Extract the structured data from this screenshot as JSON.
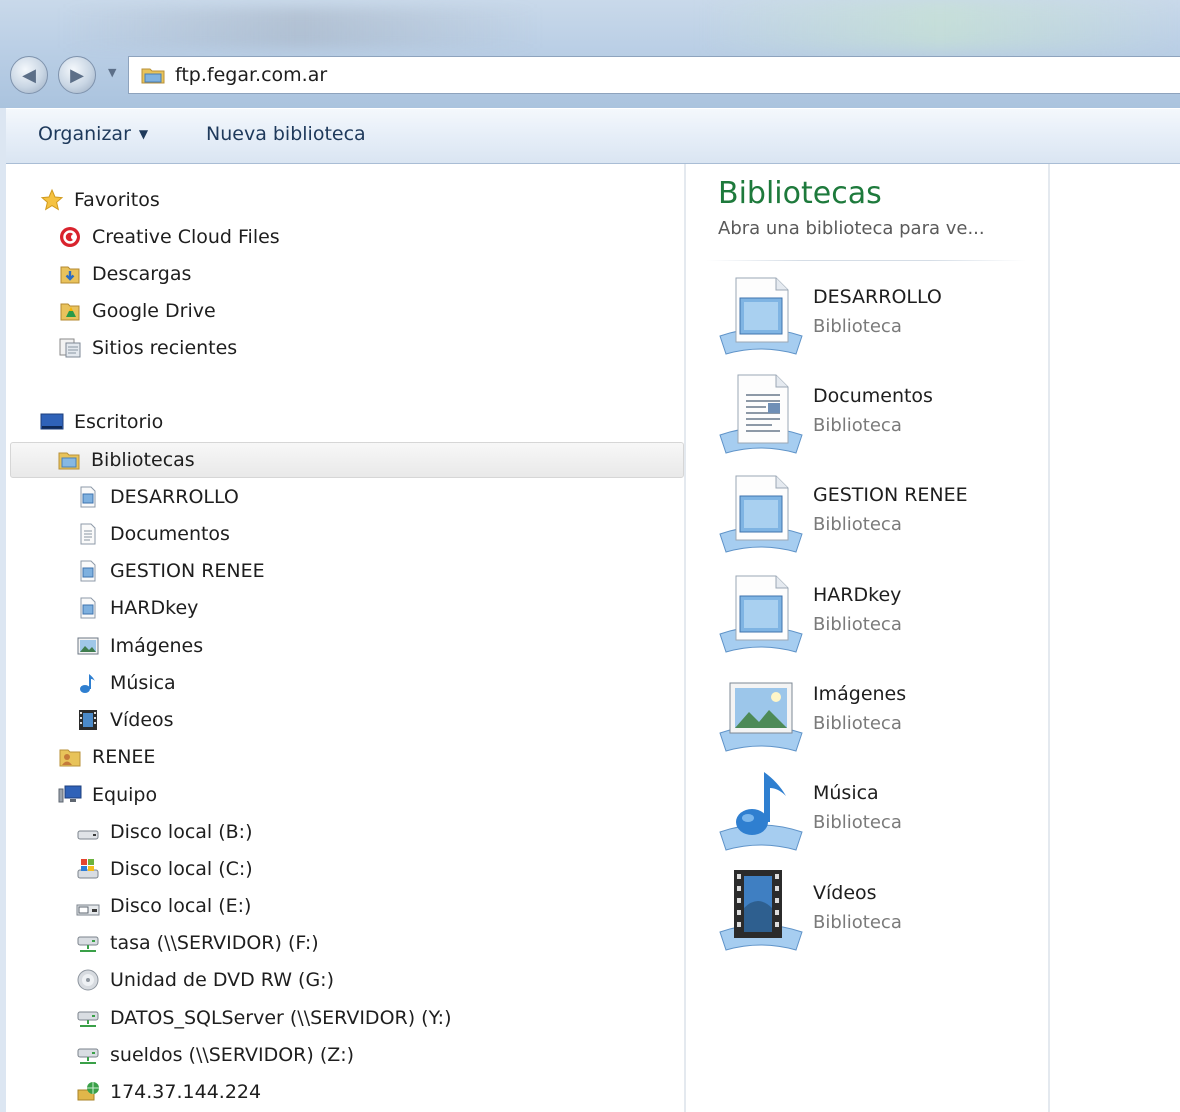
{
  "address_bar": {
    "path": "ftp.fegar.com.ar"
  },
  "toolbar": {
    "organize_label": "Organizar",
    "new_library_label": "Nueva biblioteca"
  },
  "navigation": {
    "favorites_header": "Favoritos",
    "favorites": [
      {
        "label": "Creative Cloud Files",
        "icon": "creative-cloud-icon"
      },
      {
        "label": "Descargas",
        "icon": "downloads-folder-icon"
      },
      {
        "label": "Google Drive",
        "icon": "google-drive-folder-icon"
      },
      {
        "label": "Sitios recientes",
        "icon": "recent-places-icon"
      }
    ],
    "desktop_label": "Escritorio",
    "libraries_label": "Bibliotecas",
    "libraries": [
      {
        "label": "DESARROLLO",
        "icon": "library-icon"
      },
      {
        "label": "Documentos",
        "icon": "documents-icon"
      },
      {
        "label": "GESTION RENEE",
        "icon": "library-icon"
      },
      {
        "label": "HARDkey",
        "icon": "library-icon"
      },
      {
        "label": "Imágenes",
        "icon": "pictures-icon"
      },
      {
        "label": "Música",
        "icon": "music-icon"
      },
      {
        "label": "Vídeos",
        "icon": "videos-icon"
      }
    ],
    "user_label": "RENEE",
    "computer_label": "Equipo",
    "drives": [
      {
        "label": "Disco local (B:)",
        "icon": "hard-drive-icon"
      },
      {
        "label": "Disco local (C:)",
        "icon": "system-drive-icon"
      },
      {
        "label": "Disco local (E:)",
        "icon": "hard-drive-icon"
      },
      {
        "label": "tasa (\\\\SERVIDOR) (F:)",
        "icon": "network-drive-icon"
      },
      {
        "label": "Unidad de DVD RW (G:)",
        "icon": "dvd-drive-icon"
      },
      {
        "label": "DATOS_SQLServer (\\\\SERVIDOR) (Y:)",
        "icon": "network-drive-icon"
      },
      {
        "label": "sueldos (\\\\SERVIDOR) (Z:)",
        "icon": "network-drive-icon"
      },
      {
        "label": "174.37.144.224",
        "icon": "network-location-icon"
      }
    ]
  },
  "content": {
    "title": "Bibliotecas",
    "subtitle": "Abra una biblioteca para ve...",
    "items": [
      {
        "name": "DESARROLLO",
        "type": "Biblioteca",
        "icon": "library-icon"
      },
      {
        "name": "Documentos",
        "type": "Biblioteca",
        "icon": "documents-icon"
      },
      {
        "name": "GESTION RENEE",
        "type": "Biblioteca",
        "icon": "library-icon"
      },
      {
        "name": "HARDkey",
        "type": "Biblioteca",
        "icon": "library-icon"
      },
      {
        "name": "Imágenes",
        "type": "Biblioteca",
        "icon": "pictures-icon"
      },
      {
        "name": "Música",
        "type": "Biblioteca",
        "icon": "music-icon"
      },
      {
        "name": "Vídeos",
        "type": "Biblioteca",
        "icon": "videos-icon"
      }
    ]
  },
  "colors": {
    "title_green": "#1e7a3c",
    "command_text": "#1e395b",
    "secondary_text": "#7a7a7a"
  }
}
